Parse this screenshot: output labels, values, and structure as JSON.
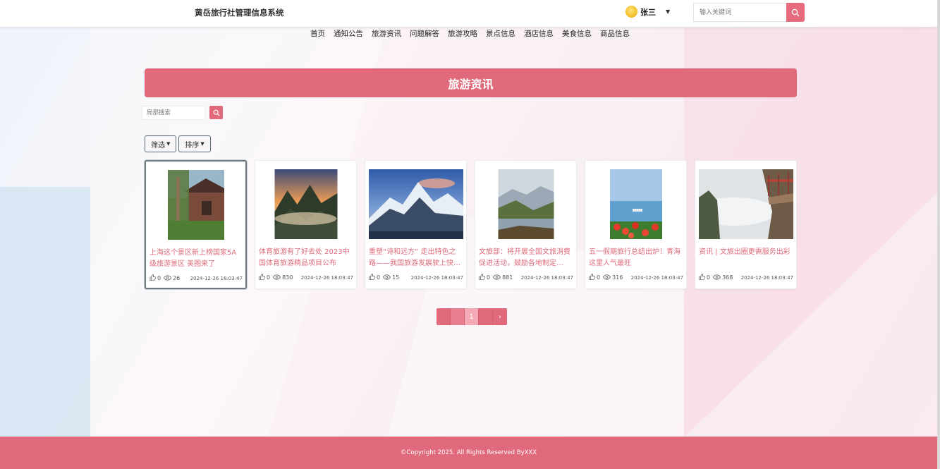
{
  "header": {
    "site_title": "黄岳旅行社管理信息系统",
    "user_name": "张三",
    "search_placeholder": "输入关键词"
  },
  "nav": {
    "items": [
      "首页",
      "通知公告",
      "旅游资讯",
      "问题解答",
      "旅游攻略",
      "景点信息",
      "酒店信息",
      "美食信息",
      "商品信息"
    ]
  },
  "banner": {
    "title": "旅游资讯"
  },
  "local_search": {
    "placeholder": "局部搜索"
  },
  "filters": {
    "filter_label": "筛选",
    "sort_label": "排序"
  },
  "cards": [
    {
      "title": "上海这个景区新上榜国家5A级旅游景区 美图来了",
      "likes": "0",
      "views": "26",
      "time": "2024-12-26 18:03:47",
      "image": "cabin-forest"
    },
    {
      "title": "体育旅游有了好去处 2023中国体育旅游精品项目公布",
      "likes": "0",
      "views": "830",
      "time": "2024-12-26 18:03:47",
      "image": "misty-mountains"
    },
    {
      "title": "重塑“诗和远方” 走出特色之路——我国旅游发展驶上快…",
      "likes": "0",
      "views": "15",
      "time": "2024-12-26 18:03:47",
      "image": "snow-mountain"
    },
    {
      "title": "文旅部：将开展全国文旅消费促进活动，鼓励各地制定…",
      "likes": "0",
      "views": "881",
      "time": "2024-12-26 18:03:47",
      "image": "lake-valley"
    },
    {
      "title": "五一假期旅行总结出炉！青海这里人气最旺",
      "likes": "0",
      "views": "316",
      "time": "2024-12-26 18:03:47",
      "image": "flowers-lake"
    },
    {
      "title": "资讯 | 文旅出圈更需服务出彩",
      "likes": "0",
      "views": "368",
      "time": "2024-12-26 18:03:47",
      "image": "cliff-walkway"
    }
  ],
  "pagination": {
    "current_page": "1"
  },
  "footer": {
    "copyright": "©Copyright 2025. All Rights Reserved ByXXX"
  },
  "colors": {
    "accent": "#e06a7b",
    "accent_light": "#f4a9b5"
  }
}
